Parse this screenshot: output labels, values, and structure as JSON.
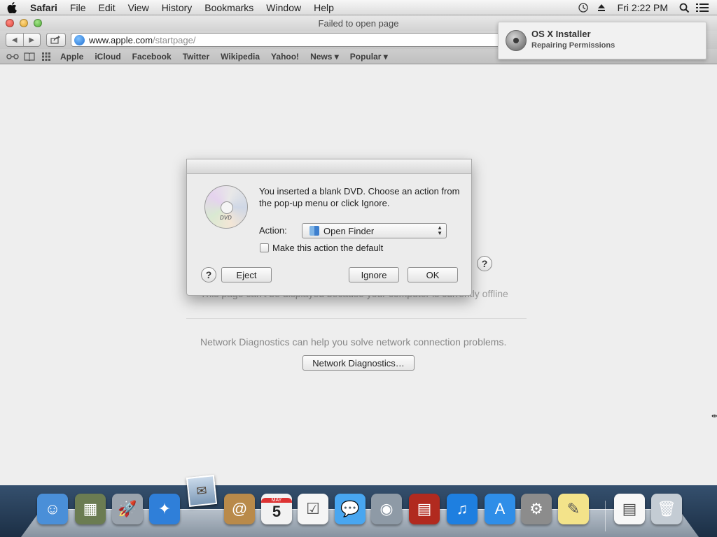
{
  "menubar": {
    "apple_icon": "apple-logo-icon",
    "items": [
      "Safari",
      "File",
      "Edit",
      "View",
      "History",
      "Bookmarks",
      "Window",
      "Help"
    ],
    "clock": "Fri 2:22 PM",
    "status_icons": [
      "time-machine-icon",
      "eject-icon",
      "spotlight-search-icon",
      "notification-center-icon"
    ]
  },
  "safari": {
    "title": "Failed to open page",
    "url_host": "www.apple.com",
    "url_path": "/startpage/",
    "bookmarks": [
      "Apple",
      "iCloud",
      "Facebook",
      "Twitter",
      "Wikipedia",
      "Yahoo!",
      "News ▾",
      "Popular ▾"
    ],
    "page": {
      "offline_text": "This page can't be displayed because your computer is currently offline",
      "diagnostics_text": "Network Diagnostics can help you solve network connection problems.",
      "diagnostics_button": "Network Diagnostics…",
      "help_symbol": "?"
    }
  },
  "notification": {
    "title": "OS X Installer",
    "body": "Repairing Permissions"
  },
  "dialog": {
    "disc_label": "DVD",
    "message": "You inserted a blank DVD. Choose an action from the pop-up menu or click Ignore.",
    "action_label": "Action:",
    "action_value": "Open Finder",
    "checkbox_label": "Make this action the default",
    "checkbox_checked": false,
    "help_symbol": "?",
    "eject_label": "Eject",
    "ignore_label": "Ignore",
    "ok_label": "OK"
  },
  "dock": {
    "apps": [
      {
        "name": "finder-icon",
        "color": "#4a8fd8",
        "glyph": "☺"
      },
      {
        "name": "iphoto-icon",
        "color": "#6b7c52",
        "glyph": "▦"
      },
      {
        "name": "launchpad-icon",
        "color": "#9aa3ad",
        "glyph": "🚀"
      },
      {
        "name": "safari-dock-icon",
        "color": "#2f7fd9",
        "glyph": "✦"
      },
      {
        "name": "contacts-icon",
        "color": "#b98a4a",
        "glyph": "@"
      },
      {
        "name": "calendar-icon",
        "color": "#f2f2f2",
        "glyph": "5"
      },
      {
        "name": "reminders-icon",
        "color": "#f5f5f5",
        "glyph": "☑"
      },
      {
        "name": "messages-icon",
        "color": "#48a6f0",
        "glyph": "💬"
      },
      {
        "name": "facetime-icon",
        "color": "#8e9aa6",
        "glyph": "◉"
      },
      {
        "name": "photo-booth-icon",
        "color": "#b12a1f",
        "glyph": "▤"
      },
      {
        "name": "itunes-icon",
        "color": "#1e7fe0",
        "glyph": "♫"
      },
      {
        "name": "app-store-icon",
        "color": "#2f8ee8",
        "glyph": "A"
      },
      {
        "name": "system-preferences-icon",
        "color": "#8c8c8c",
        "glyph": "⚙"
      },
      {
        "name": "stickies-icon",
        "color": "#f3e38a",
        "glyph": "✎"
      },
      {
        "name": "document-icon",
        "color": "#f7f7f7",
        "glyph": "▤"
      },
      {
        "name": "trash-icon",
        "color": "#c4ccd4",
        "glyph": "🗑"
      }
    ],
    "calendar_month": "MAY",
    "calendar_day": "5",
    "dragged_item": "mail-icon"
  }
}
